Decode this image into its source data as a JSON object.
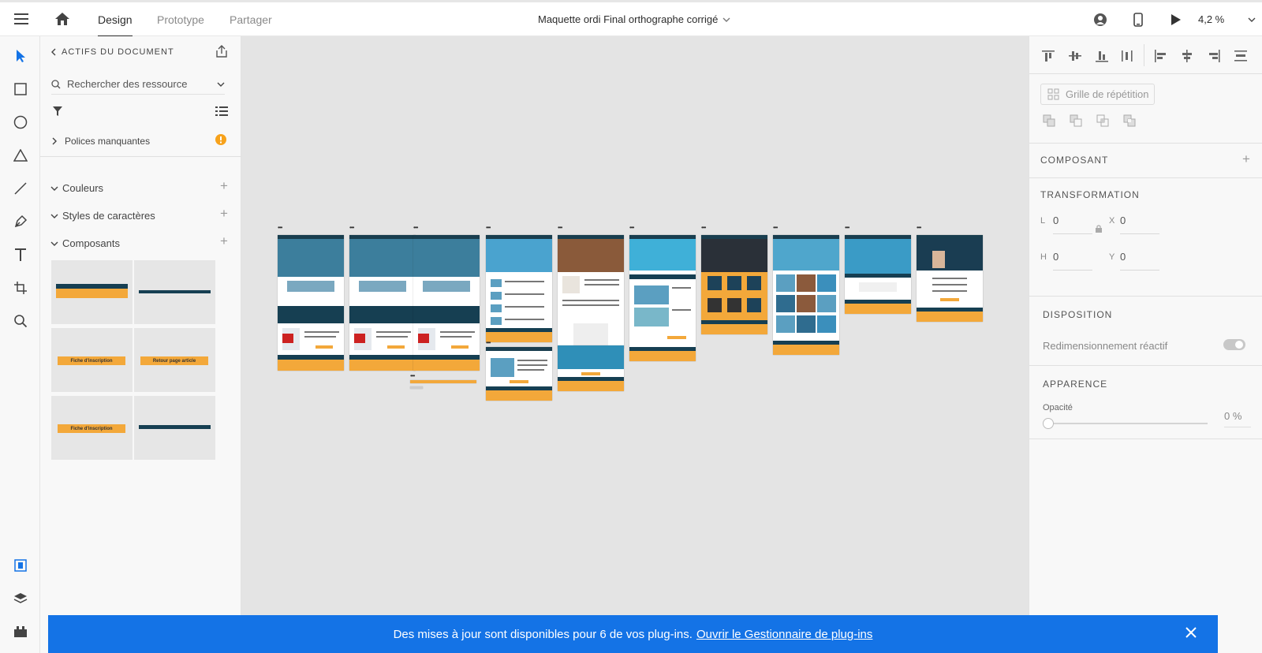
{
  "header": {
    "tabs": [
      {
        "label": "Design",
        "active": true
      },
      {
        "label": "Prototype",
        "active": false
      },
      {
        "label": "Partager",
        "active": false
      }
    ],
    "document_title": "Maquette ordi Final orthographe corrigé",
    "zoom": "4,2 %"
  },
  "assets_panel": {
    "back_label": "ACTIFS DU DOCUMENT",
    "search_placeholder": "Rechercher des ressource",
    "missing_fonts": "Polices manquantes",
    "sections": {
      "colors": "Couleurs",
      "char_styles": "Styles de caractères",
      "components": "Composants"
    },
    "components": [
      {
        "kind": "footer",
        "label": ""
      },
      {
        "kind": "navbar",
        "label": ""
      },
      {
        "kind": "button",
        "label": "Fiche d'inscription"
      },
      {
        "kind": "button",
        "label": "Retour page article"
      },
      {
        "kind": "button",
        "label": "Fiche d'inscription"
      },
      {
        "kind": "bar",
        "label": ""
      }
    ]
  },
  "properties_panel": {
    "repeat_grid": "Grille de répétition",
    "component": "COMPOSANT",
    "transformation": "TRANSFORMATION",
    "fields": {
      "L": "0",
      "X": "0",
      "H": "0",
      "Y": "0"
    },
    "layout": "DISPOSITION",
    "responsive_resize": "Redimensionnement réactif",
    "appearance": "APPARENCE",
    "opacity_label": "Opacité",
    "opacity_value": "0 %"
  },
  "banner": {
    "text": "Des mises à jour sont disponibles pour 6 de vos plug-ins.",
    "link": "Ouvrir le Gestionnaire de plug-ins"
  },
  "colors": {
    "accent_blue": "#1473e6",
    "navy": "#163f52",
    "orange": "#f3a83a",
    "warning": "#f7a21b"
  }
}
